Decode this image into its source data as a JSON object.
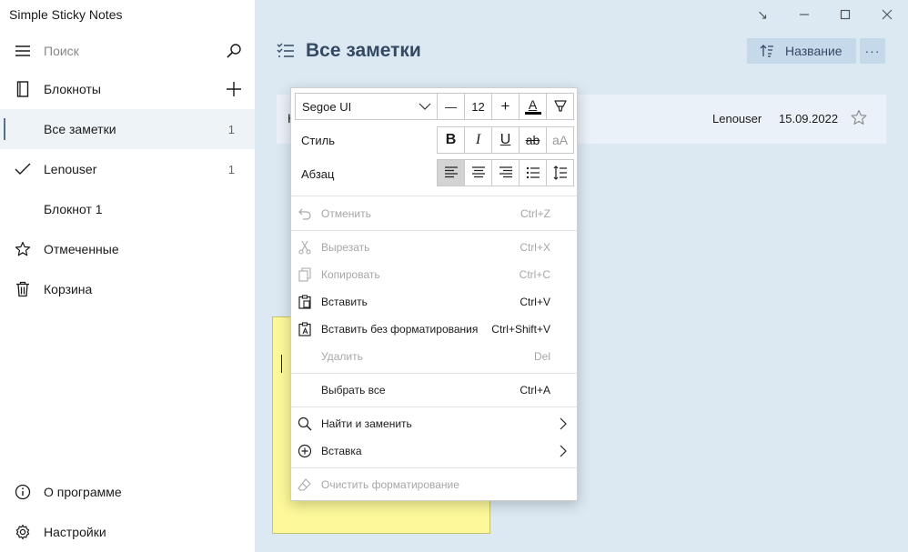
{
  "app": {
    "title": "Simple Sticky Notes"
  },
  "window_controls": {
    "snap": "↘",
    "minimize": "—",
    "maximize": "☐",
    "close": "✕"
  },
  "sidebar": {
    "search_placeholder": "Поиск",
    "notebooks_label": "Блокноты",
    "items": [
      {
        "label": "Все заметки",
        "count": "1",
        "icon": "none"
      },
      {
        "label": "Lenouser",
        "count": "1",
        "icon": "check-icon"
      },
      {
        "label": "Блокнот 1",
        "count": "",
        "icon": "none"
      },
      {
        "label": "Отмеченные",
        "count": "",
        "icon": "star-icon"
      },
      {
        "label": "Корзина",
        "count": "",
        "icon": "trash-icon"
      }
    ],
    "about_label": "О программе",
    "settings_label": "Настройки"
  },
  "main": {
    "title": "Все заметки",
    "sort_label": "Название",
    "more_label": "···",
    "note_row": {
      "title_fragment": "Н",
      "author": "Lenouser",
      "date": "15.09.2022"
    }
  },
  "context_menu": {
    "font_name": "Segoe UI",
    "font_size": "12",
    "style_label": "Стиль",
    "paragraph_label": "Абзац",
    "decrease_glyph": "—",
    "increase_glyph": "+",
    "font_color_glyph": "A",
    "bold_glyph": "B",
    "italic_glyph": "I",
    "underline_glyph": "U",
    "strike_glyph": "ab",
    "case_glyph": "aA",
    "items": {
      "undo": {
        "label": "Отменить",
        "shortcut": "Ctrl+Z"
      },
      "cut": {
        "label": "Вырезать",
        "shortcut": "Ctrl+X"
      },
      "copy": {
        "label": "Копировать",
        "shortcut": "Ctrl+C"
      },
      "paste": {
        "label": "Вставить",
        "shortcut": "Ctrl+V"
      },
      "paste_plain": {
        "label": "Вставить без форматирования",
        "shortcut": "Ctrl+Shift+V"
      },
      "delete": {
        "label": "Удалить",
        "shortcut": "Del"
      },
      "select_all": {
        "label": "Выбрать все",
        "shortcut": "Ctrl+A"
      },
      "find_replace": {
        "label": "Найти и заменить"
      },
      "insert": {
        "label": "Вставка"
      },
      "clear_format": {
        "label": "Очистить форматирование"
      }
    }
  },
  "colors": {
    "background": "#dce9f3",
    "sidebar": "#ffffff",
    "accent_text": "#344a63",
    "button_bg": "#c5d9ea",
    "sticky": "#fdf99a"
  }
}
